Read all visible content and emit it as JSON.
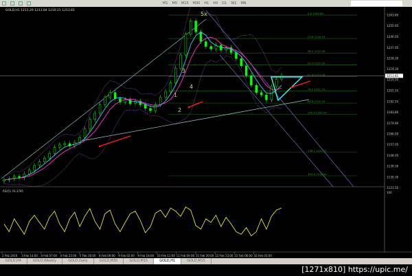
{
  "toolbar": {
    "timeframes": [
      "M1",
      "M5",
      "M15",
      "M30",
      "H1",
      "H4",
      "D1",
      "W1",
      "MN"
    ]
  },
  "header": {
    "text": "GOLD,H1  1211.29 1213.84 1210.21 1213.81"
  },
  "tabs": [
    {
      "label": "GOLD,H4"
    },
    {
      "label": "GOLD,Weekly"
    },
    {
      "label": "GOLD,Daily"
    },
    {
      "label": "GOLD,M30"
    },
    {
      "label": "GOLD,M15"
    },
    {
      "label": "GOLD,H1",
      "active": true
    },
    {
      "label": "GOLD,M15"
    }
  ],
  "watermark": "[1271x810] https://upic.me/",
  "colors": {
    "bull": "#00ff00",
    "ma_fast": "#33ccff",
    "ma_slow": "#ff33cc",
    "rsi": "#ffff33",
    "fib": "#1f6b1f",
    "arrow": "#ff2020",
    "triangle": "#33ffff"
  },
  "chart_data": {
    "type": "candlestick",
    "symbol": "GOLD,H1",
    "ylim": [
      1121.55,
      1268
    ],
    "y_ticks": [
      "1263.80",
      "1255.05",
      "1246.05",
      "1237.05",
      "1228.30",
      "1219.30",
      "1210.55",
      "1201.55",
      "1192.55",
      "1183.80",
      "1174.80",
      "1166.05",
      "1157.05",
      "1148.05",
      "1139.30",
      "1130.30",
      "1121.55"
    ],
    "current_price": "1213.81",
    "x_ticks": [
      "2 Feb 2016",
      "3 Feb 14:00",
      "4 Feb 07:00",
      "4 Feb 23:00",
      "5 Feb 16:00",
      "8 Feb 09:00",
      "9 Feb 02:00",
      "9 Feb 18:00",
      "10 Feb 11:00",
      "11 Feb 04:00",
      "11 Feb 20:00",
      "12 Feb 13:00",
      "15 Feb 06:00",
      "16 Feb 03:00"
    ],
    "closes": [
      1128,
      1129,
      1131,
      1130,
      1133,
      1136,
      1140,
      1143,
      1146,
      1150,
      1155,
      1157,
      1158,
      1156,
      1159,
      1163,
      1170,
      1178,
      1183,
      1190,
      1196,
      1200,
      1195,
      1192,
      1194,
      1191,
      1193,
      1190,
      1187,
      1185,
      1190,
      1196,
      1201,
      1208,
      1220,
      1231,
      1248,
      1259,
      1250,
      1242,
      1238,
      1236,
      1239,
      1235,
      1237,
      1233,
      1228,
      1222,
      1214,
      1206,
      1200,
      1198,
      1194,
      1205,
      1211,
      1214
    ],
    "fib_levels": [
      {
        "label": "0.0  1263.84",
        "price": 1263.84
      },
      {
        "label": "23.6  1244.53",
        "price": 1244.53
      },
      {
        "label": "38.2  1232.58",
        "price": 1232.58
      },
      {
        "label": "50.0  1222.92",
        "price": 1222.92
      },
      {
        "label": "61.8  1213.26",
        "price": 1213.26
      },
      {
        "label": "76.4  1201.31",
        "price": 1201.31
      },
      {
        "label": "88.6  1191.33",
        "price": 1191.33
      },
      {
        "label": "100.0  1182.00",
        "price": 1182.0
      },
      {
        "label": "138.2  1150.75",
        "price": 1150.75
      },
      {
        "label": "161.8  1131.44",
        "price": 1131.44
      }
    ],
    "wave_labels": [
      "5x",
      "3",
      "1",
      "4",
      "2"
    ],
    "rsi": {
      "label": "RSI(5) 76.3795",
      "ylim": [
        0,
        100
      ],
      "values": [
        45,
        30,
        55,
        40,
        25,
        50,
        62,
        48,
        35,
        58,
        70,
        45,
        30,
        55,
        68,
        40,
        60,
        75,
        50,
        35,
        65,
        72,
        45,
        30,
        48,
        65,
        70,
        52,
        28,
        40,
        66,
        72,
        58,
        76,
        70,
        60,
        78,
        72,
        42,
        35,
        55,
        48,
        62,
        40,
        58,
        45,
        30,
        25,
        38,
        22,
        30,
        55,
        35,
        60,
        72,
        76
      ]
    }
  }
}
